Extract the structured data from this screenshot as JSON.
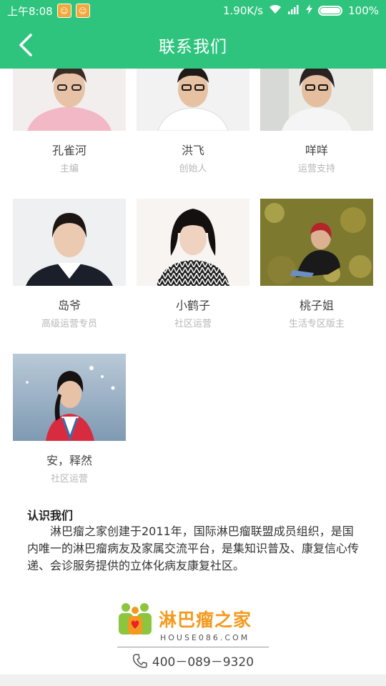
{
  "status_bar": {
    "time": "上午8:08",
    "network_speed": "1.90K/s",
    "battery": "100%"
  },
  "header": {
    "title": "联系我们"
  },
  "team": [
    {
      "name": "孔雀河",
      "role": "主编"
    },
    {
      "name": "洪飞",
      "role": "创始人"
    },
    {
      "name": "咩咩",
      "role": "运营支持"
    },
    {
      "name": "岛爷",
      "role": "高级运营专员"
    },
    {
      "name": "小鹤子",
      "role": "社区运营"
    },
    {
      "name": "桃子姐",
      "role": "生活专区版主"
    },
    {
      "name": "安，释然",
      "role": "社区运营"
    }
  ],
  "about": {
    "title": "认识我们",
    "text": "淋巴瘤之家创建于2011年，国际淋巴瘤联盟成员组织，是国内唯一的淋巴瘤病友及家属交流平台，是集知识普及、康复信心传递、会诊服务提供的立体化病友康复社区。"
  },
  "footer": {
    "logo_text": "淋巴瘤之家",
    "logo_sub": "HOUSE086.COM",
    "phone": "400－089－9320"
  },
  "colors": {
    "brand_green": "#2fc47e",
    "logo_orange": "#f39a1e"
  }
}
